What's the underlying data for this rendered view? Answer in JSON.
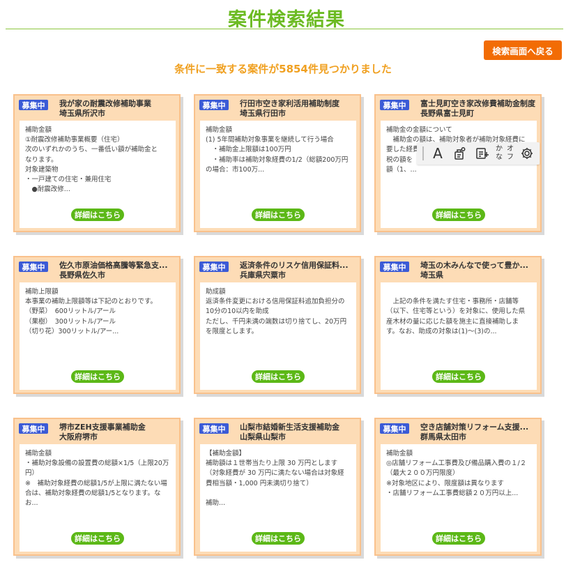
{
  "header": {
    "title": "案件検索結果",
    "back_label": "検索画面へ戻る",
    "summary": "条件に一致する案件が5854件見つかりました"
  },
  "cards": [
    {
      "badge": "募集中",
      "title": "我が家の耐震改修補助事業",
      "region": "埼玉県所沢市",
      "desc": "補助金額\n①耐震改修補助事業概要（住宅）\n次のいずれかのうち、一番低い額が補助金と\nなります。\n対象建築物\n・一戸建ての住宅・兼用住宅\n　●耐震改修...",
      "detail_label": "詳細はこちら"
    },
    {
      "badge": "募集中",
      "title": "行田市空き家利活用補助制度",
      "region": "埼玉県行田市",
      "desc": "補助金額\n(1) 5年間補助対象事業を継続して行う場合\n　・補助金上限額は100万円\n　・補助率は補助対象経費の1/2（総額200万円\nの場合：市100万...",
      "detail_label": "詳細はこちら"
    },
    {
      "badge": "募集中",
      "title": "富士見町空き家改修費補助金制度",
      "region": "長野県富士見町",
      "desc": "補助金の金額について\n　補助金の額は、補助対象者が補助対象経費に\n要した経費\n税の額を\n額（1、...",
      "detail_label": "詳細はこちら"
    },
    {
      "badge": "募集中",
      "title": "佐久市原油価格高騰等緊急支...",
      "region": "長野県佐久市",
      "desc": "補助上限額\n本事業の補助上限額等は下記のとおりです。\n（野菜）　600リットル/アール\n（果樹）　300リットル/アール\n（切り花）300リットル/アー...",
      "detail_label": "詳細はこちら"
    },
    {
      "badge": "募集中",
      "title": "返済条件のリスケ信用保証料...",
      "region": "兵庫県宍粟市",
      "desc": "助成額\n返済条件変更における信用保証料追加負担分の\n10分の10以内を助成\nただし、千円未満の端数は切り捨てし、20万円\nを限度とします。",
      "detail_label": "詳細はこちら"
    },
    {
      "badge": "募集中",
      "title": "埼玉の木みんなで使って豊か...",
      "region": "埼玉県",
      "desc": "\n　上記の条件を満たす住宅・事務所・店舗等\n（以下、住宅等という）を対象に、使用した県\n産木材の量に応じた額を施主に直接補助しま\nす。なお、助成の対象は(1)～(3)の...",
      "detail_label": "詳細はこちら"
    },
    {
      "badge": "募集中",
      "title": "堺市ZEH支援事業補助金",
      "region": "大阪府堺市",
      "desc": "補助金額\n・補助対象設備の設置費の総額×1/5（上限20万\n円）\n※　補助対象経費の総額1/5が上限に満たない場\n合は、補助対象経費の総額1/5となります。な\nお...",
      "detail_label": "詳細はこちら"
    },
    {
      "badge": "募集中",
      "title": "山梨市結婚新生活支援補助金",
      "region": "山梨県山梨市",
      "desc": "【補助金額】\n補助額は１世帯当たり上限 30 万円とします\n（対象経費が 30 万円に満たない場合は対象経\n費相当額・1,000 円未満切り捨て）\n\n補助...",
      "detail_label": "詳細はこちら"
    },
    {
      "badge": "募集中",
      "title": "空き店舗対策リフォーム支援...",
      "region": "群馬県太田市",
      "desc": "補助金額\n◎店舗リフォーム工事費及び備品購入費の１/２\n（最大２００万円限度）\n※対象地区により、限度額は異なります\n・店舗リフォーム工事費総額２０万円以上...",
      "detail_label": "詳細はこちら"
    }
  ],
  "toolbar": {
    "text_icon": "A",
    "kana_label_top": "かな",
    "kana_label_bottom": "オフ",
    "icons": [
      "text-size-icon",
      "speech-icon",
      "translate-icon",
      "kana-toggle",
      "gear-icon"
    ]
  },
  "colors": {
    "title": "#6cbb23",
    "accent": "#f26c05",
    "summary": "#f0a020",
    "badge": "#3b5bd6",
    "card_bg": "#fddcb6",
    "detail_button": "#5cb817"
  }
}
